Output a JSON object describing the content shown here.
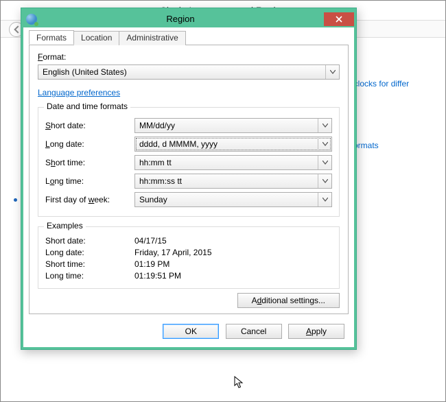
{
  "background": {
    "title": "Clock, Language, and Region",
    "link_add_clocks": "Add clocks for differ",
    "link_formats": "per formats"
  },
  "dialog": {
    "title": "Region",
    "tabs": {
      "formats": "Formats",
      "location": "Location",
      "administrative": "Administrative"
    },
    "format_label": "Format:",
    "format_value": "English (United States)",
    "language_preferences": "Language preferences",
    "group_formats": {
      "legend": "Date and time formats",
      "short_date_label": "Short date:",
      "short_date_value": "MM/dd/yy",
      "long_date_label": "Long date:",
      "long_date_value": "dddd, d MMMM, yyyy",
      "short_time_label": "Short time:",
      "short_time_value": "hh:mm tt",
      "long_time_label": "Long time:",
      "long_time_value": "hh:mm:ss tt",
      "first_day_label": "First day of week:",
      "first_day_value": "Sunday"
    },
    "group_examples": {
      "legend": "Examples",
      "short_date_label": "Short date:",
      "short_date_value": "04/17/15",
      "long_date_label": "Long date:",
      "long_date_value": "Friday, 17 April, 2015",
      "short_time_label": "Short time:",
      "short_time_value": "01:19 PM",
      "long_time_label": "Long time:",
      "long_time_value": "01:19:51 PM"
    },
    "additional_settings": "Additional settings...",
    "buttons": {
      "ok": "OK",
      "cancel": "Cancel",
      "apply": "Apply"
    }
  }
}
